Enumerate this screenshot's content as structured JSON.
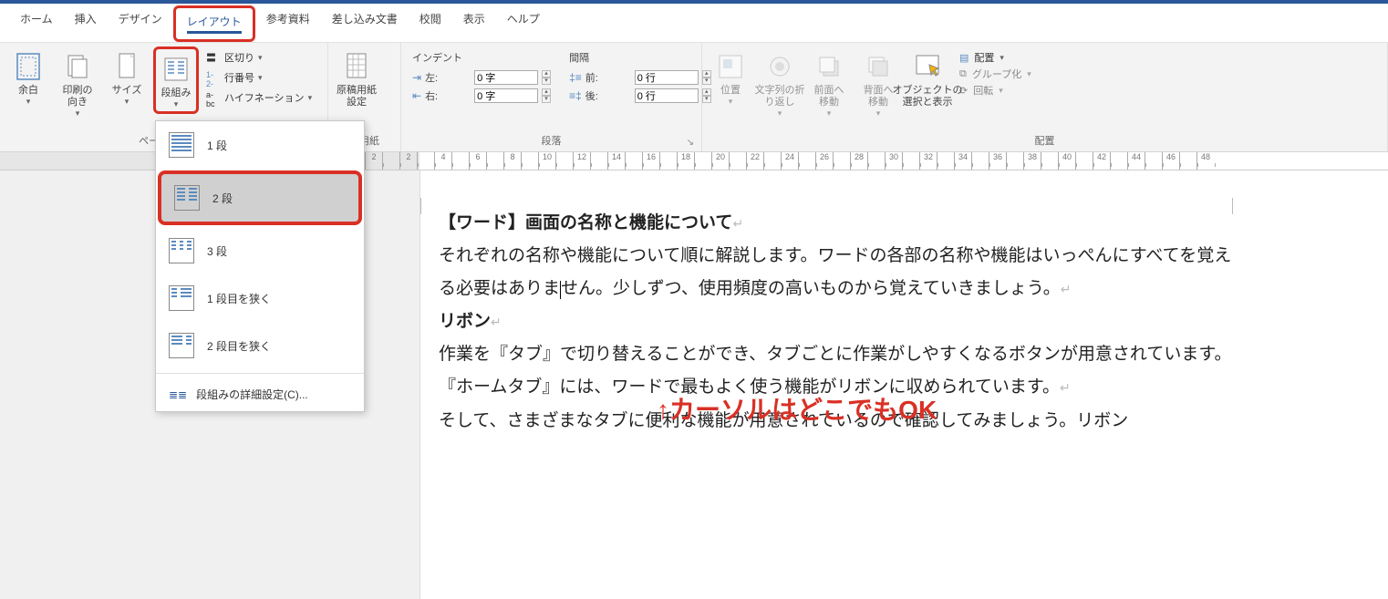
{
  "tabs": {
    "home": "ホーム",
    "insert": "挿入",
    "design": "デザイン",
    "layout": "レイアウト",
    "references": "参考資料",
    "mailings": "差し込み文書",
    "review": "校閲",
    "view": "表示",
    "help": "ヘルプ"
  },
  "page_setup": {
    "margins": "余白",
    "orientation": "印刷の\n向き",
    "size": "サイズ",
    "columns": "段組み",
    "breaks": "区切り",
    "line_numbers": "行番号",
    "hyphenation": "ハイフネーション",
    "group_label": "ページ設定"
  },
  "manuscript": {
    "btn": "原稿用紙\n設定",
    "group_label": "稿用紙"
  },
  "paragraph": {
    "indent_head": "インデント",
    "spacing_head": "間隔",
    "left_label": "左:",
    "right_label": "右:",
    "before_label": "前:",
    "after_label": "後:",
    "left_val": "0 字",
    "right_val": "0 字",
    "before_val": "0 行",
    "after_val": "0 行",
    "group_label": "段落"
  },
  "arrange": {
    "position": "位置",
    "wrap": "文字列の折\nり返し",
    "forward": "前面へ\n移動",
    "backward": "背面へ\n移動",
    "selection": "オブジェクトの\n選択と表示",
    "align": "配置",
    "group": "グループ化",
    "rotate": "回転",
    "group_label": "配置"
  },
  "columns_menu": {
    "one": "1 段",
    "two": "2 段",
    "three": "3 段",
    "narrow_left": "1 段目を狭く",
    "narrow_right": "2 段目を狭く",
    "more": "段組みの詳細設定(C)..."
  },
  "document": {
    "heading1": "【ワード】画面の名称と機能について",
    "para1": "それぞれの名称や機能について順に解説します。ワードの各部の名称や機能はいっぺんにすべてを覚える必要はありま",
    "para1b": "せん。少しずつ、使用頻度の高いものから覚えていきましょう。",
    "heading2": "リボン",
    "para2": "作業を『タブ』で切り替えることができ、タブごとに作業がしやすくなるボタンが用意されています。『ホームタブ』には、ワードで最もよく使う機能がリボンに収められています。",
    "para3": "そして、さまざまなタブに便利な機能が用意されているので確認してみましょう。リボン"
  },
  "annotation": "↑カーソルはどこでもOK",
  "ruler_ticks": [
    "2",
    "",
    "2",
    "",
    "4",
    "",
    "6",
    "",
    "8",
    "",
    "10",
    "",
    "12",
    "",
    "14",
    "",
    "16",
    "",
    "18",
    "",
    "20",
    "",
    "22",
    "",
    "24",
    "",
    "26",
    "",
    "28",
    "",
    "30",
    "",
    "32",
    "",
    "34",
    "",
    "36",
    "",
    "38",
    "",
    "40",
    "",
    "42",
    "",
    "44",
    "",
    "46",
    "",
    "48"
  ]
}
